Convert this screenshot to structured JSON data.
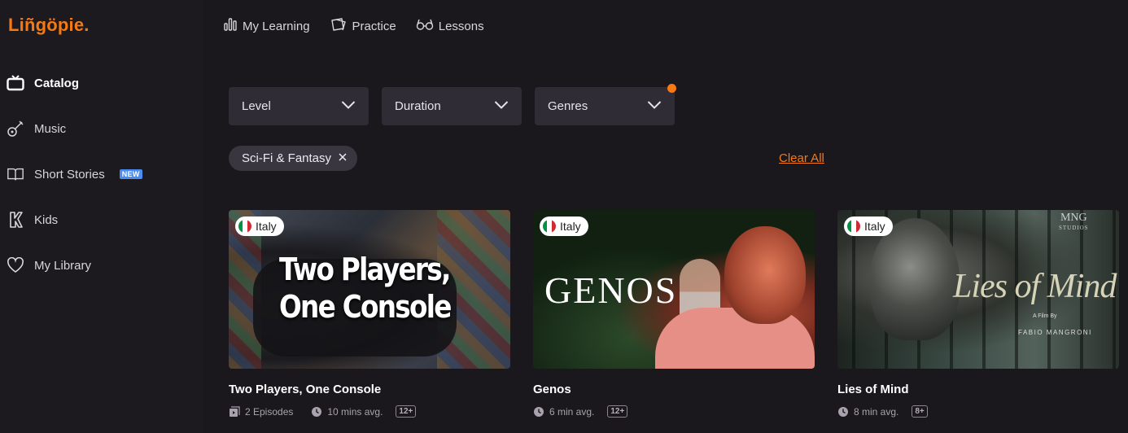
{
  "brand": {
    "name": "Liñgöpie.",
    "accent": "#f57a15"
  },
  "sidebar": {
    "items": [
      {
        "label": "Catalog",
        "icon": "tv-icon",
        "active": true
      },
      {
        "label": "Music",
        "icon": "guitar-icon"
      },
      {
        "label": "Short Stories",
        "icon": "book-icon",
        "badge": "NEW"
      },
      {
        "label": "Kids",
        "icon": "kids-icon"
      },
      {
        "label": "My Library",
        "icon": "heart-icon"
      }
    ]
  },
  "topnav": {
    "items": [
      {
        "label": "My Learning",
        "icon": "bar-chart-icon"
      },
      {
        "label": "Practice",
        "icon": "cards-icon"
      },
      {
        "label": "Lessons",
        "icon": "glasses-icon"
      }
    ]
  },
  "filters": {
    "level": "Level",
    "duration": "Duration",
    "genres": "Genres"
  },
  "active_filter": "Sci-Fi & Fantasy",
  "clear_all": "Clear All",
  "cards": [
    {
      "title": "Two Players, One Console",
      "country": "Italy",
      "episodes": "2 Episodes",
      "duration": "10 mins avg.",
      "age": "12+",
      "art_text": [
        "Two Players,",
        "One Console"
      ]
    },
    {
      "title": "Genos",
      "country": "Italy",
      "duration": "6 min avg.",
      "age": "12+",
      "art_text": "GENOS"
    },
    {
      "title": "Lies of Mind",
      "country": "Italy",
      "duration": "8 min avg.",
      "age": "8+",
      "art_text": "Lies of Mind",
      "art_small": "A Film By",
      "art_director": "FABIO MANGRONI",
      "art_studio": "MNG",
      "art_studio_sub": "STUDIOS"
    }
  ]
}
